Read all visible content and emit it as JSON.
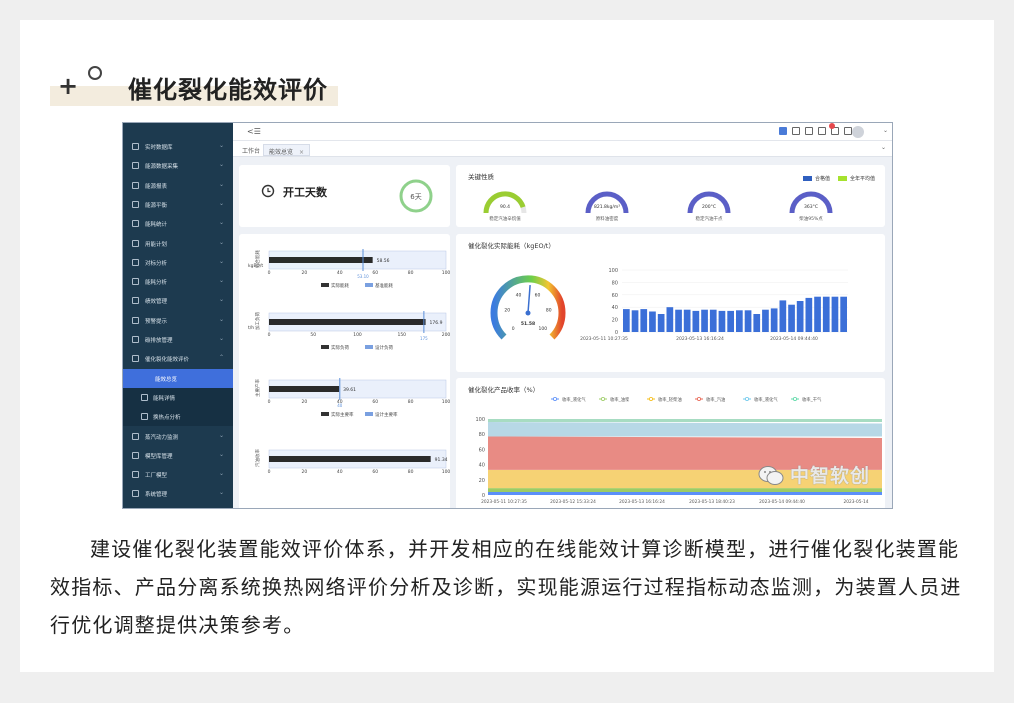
{
  "heading": {
    "plus": "+",
    "title": "催化裂化能效评价"
  },
  "app": {
    "collapse_icon": "collapse-icon",
    "tabs": [
      {
        "label": "工作台"
      },
      {
        "label": "能效总览",
        "closable": "×"
      }
    ],
    "sidebar": [
      {
        "label": "实时数据库",
        "icon": "database-icon"
      },
      {
        "label": "能源数据采集",
        "icon": "collect-icon"
      },
      {
        "label": "能源报表",
        "icon": "report-icon"
      },
      {
        "label": "能源平衡",
        "icon": "balance-icon"
      },
      {
        "label": "能耗统计",
        "icon": "stats-icon"
      },
      {
        "label": "用能计划",
        "icon": "plan-icon"
      },
      {
        "label": "对标分析",
        "icon": "benchmark-icon"
      },
      {
        "label": "能耗分析",
        "icon": "analysis-icon"
      },
      {
        "label": "绩效管理",
        "icon": "performance-icon"
      },
      {
        "label": "预警提示",
        "icon": "alert-icon"
      },
      {
        "label": "碳排放管理",
        "icon": "carbon-icon"
      },
      {
        "label": "催化裂化能效评价",
        "icon": "evaluation-icon"
      },
      {
        "label": "能效总览",
        "icon": ""
      },
      {
        "label": "能耗详情",
        "icon": "detail-icon"
      },
      {
        "label": "换热点分析",
        "icon": "heat-icon"
      },
      {
        "label": "蒸汽动力监测",
        "icon": "steam-icon"
      },
      {
        "label": "模型库管理",
        "icon": "model-icon"
      },
      {
        "label": "工厂模型",
        "icon": "factory-icon"
      },
      {
        "label": "系统管理",
        "icon": "system-icon"
      }
    ],
    "days": {
      "title": "开工天数",
      "value": "6天"
    },
    "key_quality": {
      "title": "关键性质",
      "legend": [
        {
          "label": "合格值",
          "color": "#2f5fbf"
        },
        {
          "label": "全年平均值",
          "color": "#a6e22e"
        }
      ],
      "gauges": [
        {
          "value": "90.4",
          "label": "稳定汽油辛烷值",
          "color": "#9acd32",
          "level": 0.9
        },
        {
          "value": "821.8kg/m³",
          "label": "原料油密度",
          "color": "#5b5fc7",
          "level": 1.0
        },
        {
          "value": "200°C",
          "label": "稳定汽油干点",
          "color": "#5b5fc7",
          "level": 1.0
        },
        {
          "value": "363°C",
          "label": "柴油95%点",
          "color": "#5b5fc7",
          "level": 1.0
        }
      ]
    },
    "energy_panel": {
      "title": "催化裂化实际能耗（kgEO/t）",
      "dial_value": "51.58",
      "dial_ticks": [
        "0",
        "20",
        "40",
        "60",
        "80",
        "100"
      ],
      "y_ticks": [
        "0",
        "20",
        "40",
        "60",
        "80",
        "100"
      ],
      "x_labels": [
        "2023-05-11  10:27:35",
        "2023-05-13  16:16:24",
        "2023-05-14  09:44:40"
      ],
      "bars": [
        37,
        35,
        37,
        33,
        29,
        40,
        36,
        36,
        34,
        36,
        36,
        34,
        34,
        35,
        35,
        29,
        36,
        38,
        51,
        44,
        50,
        55,
        57,
        57,
        57,
        57
      ]
    },
    "bullets": [
      {
        "axis": "kgEO/t",
        "ylabel": "综合能耗",
        "ticks": [
          "0",
          "20",
          "40",
          "60",
          "80",
          "100"
        ],
        "value_label": "58.56",
        "target_label": "53.10",
        "fraction": 0.5856,
        "target": 0.531,
        "legend": [
          "实际能耗",
          "基准能耗"
        ]
      },
      {
        "axis": "t/h",
        "ylabel": "加工负荷",
        "ticks": [
          "0",
          "50",
          "100",
          "150",
          "200"
        ],
        "value_label": "176.9",
        "target_label": "175",
        "fraction": 0.8845,
        "target": 0.875,
        "legend": [
          "实际负荷",
          "设计负荷"
        ]
      },
      {
        "axis": "",
        "ylabel": "主要产率",
        "ticks": [
          "0",
          "20",
          "40",
          "60",
          "80",
          "100"
        ],
        "value_label": "39.61",
        "target_label": "40",
        "fraction": 0.3961,
        "target": 0.4,
        "legend": [
          "实际主要率",
          "设计主要率"
        ]
      },
      {
        "axis": "",
        "ylabel": "汽油收率",
        "ticks": [
          "0",
          "20",
          "40",
          "60",
          "80",
          "100"
        ],
        "value_label": "91.34",
        "target_label": "",
        "fraction": 0.9134,
        "target": 0.0,
        "legend": []
      }
    ],
    "yield_panel": {
      "title": "催化裂化产品收率（%）",
      "legend": [
        {
          "label": "收率_液化气",
          "color": "#5b8ff9"
        },
        {
          "label": "收率_油浆",
          "color": "#9ccc65"
        },
        {
          "label": "收率_轻柴油",
          "color": "#f6bd16"
        },
        {
          "label": "收率_汽油",
          "color": "#e86452"
        },
        {
          "label": "收率_液化气",
          "color": "#6dc8ec"
        },
        {
          "label": "收率_干气",
          "color": "#5ad8a6"
        }
      ],
      "y_ticks": [
        "0",
        "20",
        "40",
        "60",
        "80",
        "100"
      ],
      "x_labels": [
        "2023-05-11  10:27:35",
        "2023-05-12  15:33:24",
        "2023-05-13  16:16:24",
        "2023-05-13  18:40:23",
        "2023-05-14  09:44:40",
        "2023-05-14"
      ]
    }
  },
  "watermark": "中智软创",
  "body": "建设催化裂化装置能效评价体系，并开发相应的在线能效计算诊断模型，进行催化裂化装置能效指标、产品分离系统换热网络评价分析及诊断，实现能源运行过程指标动态监测，为装置人员进行优化调整提供决策参考。"
}
